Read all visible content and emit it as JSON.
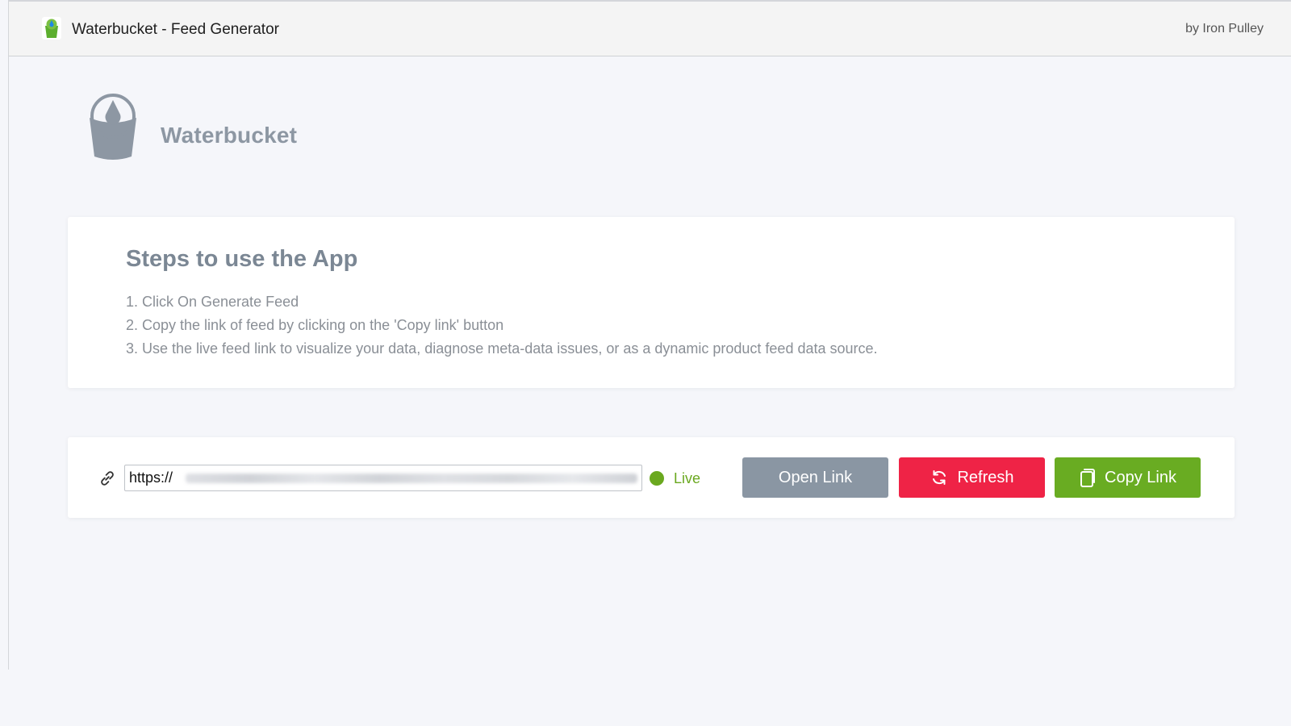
{
  "header": {
    "title": "Waterbucket - Feed Generator",
    "byline": "by Iron Pulley"
  },
  "logo": {
    "text": "Waterbucket"
  },
  "steps": {
    "title": "Steps to use the App",
    "items": [
      "1. Click On Generate Feed",
      "2. Copy the link of feed by clicking on the 'Copy link' button",
      "3. Use the live feed link to visualize your data, diagnose meta-data issues, or as a dynamic product feed data source."
    ]
  },
  "feed": {
    "url_value": "https://",
    "status": "Live",
    "status_color": "#6aa81f",
    "open_label": "Open Link",
    "refresh_label": "Refresh",
    "copy_label": "Copy Link"
  },
  "colors": {
    "open_button": "#8a96a3",
    "refresh_button": "#ef2346",
    "copy_button": "#69ac22"
  },
  "icons": {
    "app": "water-bucket-icon",
    "link": "link-icon",
    "refresh": "refresh-icon",
    "copy": "copy-icon"
  }
}
